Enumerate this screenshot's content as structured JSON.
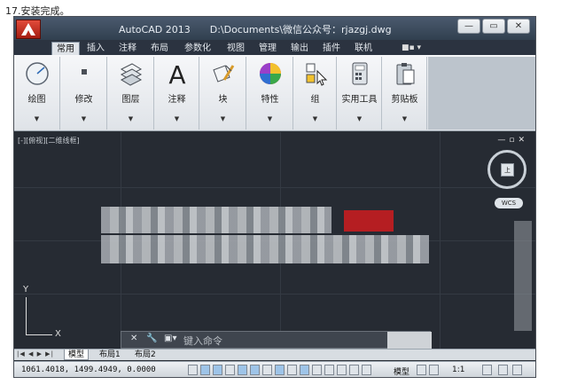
{
  "caption": "17.安装完成。",
  "window": {
    "app_title": "AutoCAD 2013",
    "doc_path": "D:\\Documents\\微信公众号：rjazgj.dwg",
    "controls": [
      "—",
      "▭",
      "✕"
    ]
  },
  "ribbon": {
    "tabs": [
      {
        "label": "常用",
        "active": true
      },
      {
        "label": "插入"
      },
      {
        "label": "注释"
      },
      {
        "label": "布局"
      },
      {
        "label": "参数化"
      },
      {
        "label": "视图"
      },
      {
        "label": "管理"
      },
      {
        "label": "输出"
      },
      {
        "label": "插件"
      },
      {
        "label": "联机"
      }
    ],
    "tab_extra": "■▪ ▾",
    "groups": [
      {
        "label": "绘图",
        "icon": "draw-circle-icon"
      },
      {
        "label": "修改",
        "icon": "modify-icon"
      },
      {
        "label": "图层",
        "icon": "layers-icon"
      },
      {
        "label": "注释",
        "icon": "annotation-text-icon"
      },
      {
        "label": "块",
        "icon": "block-icon"
      },
      {
        "label": "特性",
        "icon": "color-wheel-icon"
      },
      {
        "label": "组",
        "icon": "group-icon"
      },
      {
        "label": "实用工具",
        "icon": "calculator-icon"
      },
      {
        "label": "剪贴板",
        "icon": "clipboard-icon"
      }
    ],
    "dropdown_glyph": "▼"
  },
  "viewport": {
    "label": "[-][俯视][二维线框]",
    "controls": "—▫✕",
    "viewcube_face": "上",
    "wcs_label": "WCS",
    "ucs_x": "X",
    "ucs_y": "Y"
  },
  "command_line": {
    "close_glyph": "✕",
    "tool_glyph": "🔧",
    "prompt": "键入命令"
  },
  "layout_tabs": {
    "nav": "|◀ ◀ ▶ ▶|",
    "tabs": [
      {
        "label": "模型",
        "active": true
      },
      {
        "label": "布局1"
      },
      {
        "label": "布局2"
      }
    ]
  },
  "status_bar": {
    "coordinates": "1061.4018, 1499.4949, 0.0000",
    "model_label": "模型",
    "scale": "1:1"
  }
}
